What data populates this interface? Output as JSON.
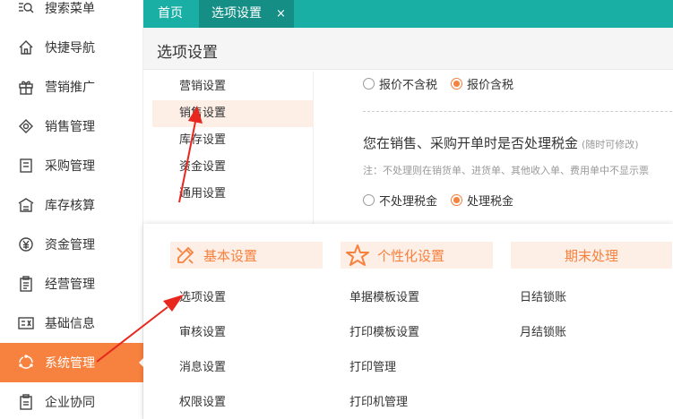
{
  "sidebar": {
    "items": [
      {
        "label": "搜索菜单",
        "icon": "search-menu-icon"
      },
      {
        "label": "快捷导航",
        "icon": "home-icon"
      },
      {
        "label": "营销推广",
        "icon": "gift-icon"
      },
      {
        "label": "销售管理",
        "icon": "sales-icon"
      },
      {
        "label": "采购管理",
        "icon": "cart-icon"
      },
      {
        "label": "库存核算",
        "icon": "warehouse-icon"
      },
      {
        "label": "资金管理",
        "icon": "money-icon"
      },
      {
        "label": "经营管理",
        "icon": "clipboard-icon"
      },
      {
        "label": "基础信息",
        "icon": "id-card-icon"
      },
      {
        "label": "系统管理",
        "icon": "system-icon"
      },
      {
        "label": "企业协同",
        "icon": "collab-icon"
      }
    ],
    "active_index": 9
  },
  "tabs": {
    "home": "首页",
    "options": "选项设置",
    "close": "×"
  },
  "page": {
    "title": "选项设置"
  },
  "settings_nav": {
    "items": [
      "营销设置",
      "销售设置",
      "库存设置",
      "资金设置",
      "通用设置"
    ],
    "active_index": 1
  },
  "content": {
    "price_opt1": "报价不含税",
    "price_opt2": "报价含税",
    "question": "您在销售、采购开单时是否处理税金",
    "question_hint": "(随时可修改)",
    "note": "注：不处理则在销货单、进货单、其他收入单、费用单中不显示票",
    "tax_opt1": "不处理税金",
    "tax_opt2": "处理税金"
  },
  "menu": {
    "col1": {
      "title": "基本设置",
      "icon": "pencil-ruler-icon",
      "items": [
        "选项设置",
        "审核设置",
        "消息设置",
        "权限设置"
      ]
    },
    "col2": {
      "title": "个性化设置",
      "icon": "star-icon",
      "items": [
        "单据模板设置",
        "打印模板设置",
        "打印管理",
        "打印机管理"
      ]
    },
    "col3": {
      "title": "期末处理",
      "items": [
        "日结锁账",
        "月结锁账"
      ]
    }
  },
  "colors": {
    "accent": "#f7813e",
    "teal": "#1aafa5",
    "teal_dark": "#158e86",
    "highlight_bg": "#fdeee6",
    "annotation": "#e8281e"
  }
}
